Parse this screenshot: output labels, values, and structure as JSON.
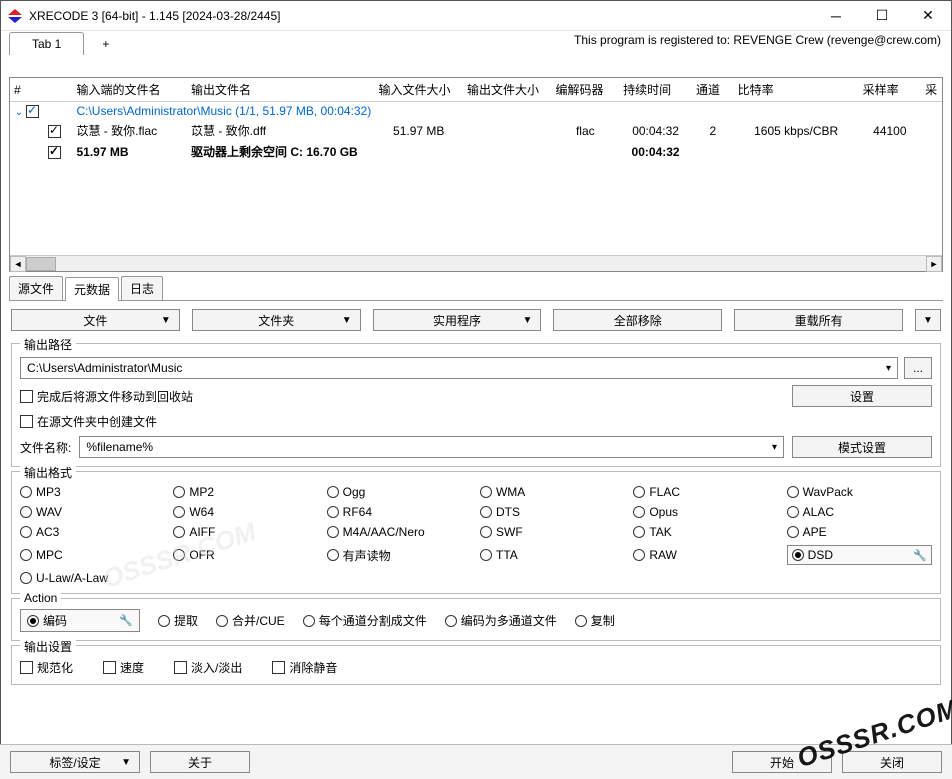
{
  "window": {
    "title": "XRECODE 3 [64-bit] - 1.145 [2024-03-28/2445]",
    "registration": "This program is registered to: REVENGE Crew (revenge@crew.com)"
  },
  "tabs": {
    "main": "Tab 1",
    "add": "+"
  },
  "grid_headers": {
    "num": "#",
    "input_fname": "输入端的文件名",
    "output_fname": "输出文件名",
    "input_size": "输入文件大小",
    "output_size": "输出文件大小",
    "codec": "编解码器",
    "duration": "持续时间",
    "channels": "通道",
    "bitrate": "比特率",
    "samplerate": "采样率",
    "extra": "采"
  },
  "grid_rows": {
    "folder": "C:\\Users\\Administrator\\Music (1/1, 51.97 MB, 00:04:32)",
    "file": {
      "in_name": "苡慧 - 致你.flac",
      "out_name": "苡慧 - 致你.dff",
      "in_size": "51.97 MB",
      "codec": "flac",
      "duration": "00:04:32",
      "channels": "2",
      "bitrate": "1605 kbps/CBR",
      "samplerate": "44100"
    },
    "summary": {
      "total_size": "51.97 MB",
      "freespace": "驱动器上剩余空间 C: 16.70 GB",
      "total_dur": "00:04:32"
    }
  },
  "subtabs": {
    "source": "源文件",
    "meta": "元数据",
    "log": "日志"
  },
  "buttons": {
    "file": "文件",
    "folder": "文件夹",
    "utility": "实用程序",
    "remove_all": "全部移除",
    "reload_all": "重载所有",
    "settings": "设置",
    "pattern_settings": "模式设置",
    "tags_settings": "标签/设定",
    "about": "关于",
    "start": "开始",
    "close": "关闭",
    "browse": "..."
  },
  "output": {
    "group_label": "输出路径",
    "path": "C:\\Users\\Administrator\\Music",
    "move_recycle": "完成后将源文件移动到回收站",
    "create_in_src": "在源文件夹中创建文件",
    "filename_label": "文件名称:",
    "filename_pattern": "%filename%"
  },
  "formats": {
    "group_label": "输出格式",
    "items": [
      "MP3",
      "MP2",
      "Ogg",
      "WMA",
      "FLAC",
      "WavPack",
      "WAV",
      "W64",
      "RF64",
      "DTS",
      "Opus",
      "ALAC",
      "AC3",
      "AIFF",
      "M4A/AAC/Nero",
      "SWF",
      "TAK",
      "APE",
      "MPC",
      "OFR",
      "有声读物",
      "TTA",
      "RAW",
      "DSD"
    ],
    "ulaw": "U-Law/A-Law",
    "selected": "DSD"
  },
  "actions": {
    "group_label": "Action",
    "items": [
      "编码",
      "提取",
      "合并/CUE",
      "每个通道分割成文件",
      "编码为多通道文件",
      "复制"
    ],
    "selected": "编码"
  },
  "outsettings": {
    "group_label": "输出设置",
    "items": [
      "规范化",
      "速度",
      "淡入/淡出",
      "消除静音"
    ]
  },
  "watermark": "OSSSR.COM"
}
